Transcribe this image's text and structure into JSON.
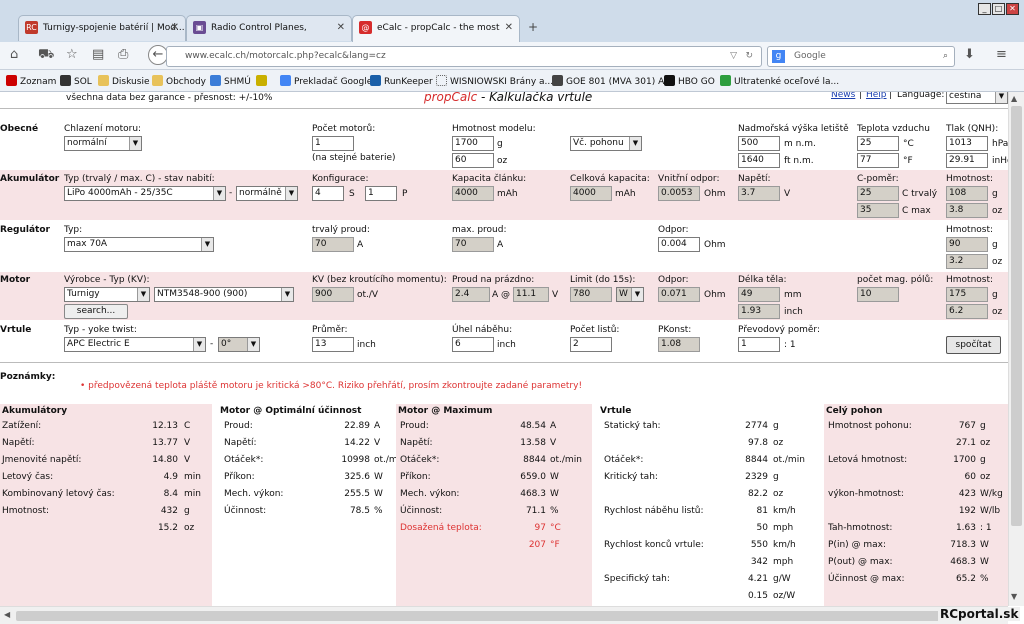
{
  "browser": {
    "tabs": [
      {
        "label": "Turnigy-spojenie batérií | Mod...",
        "fav": "RC",
        "fav_color": "#c0392b"
      },
      {
        "label": "Radio Control Planes, Helicop...",
        "fav": "▣",
        "fav_color": "#6a4c93"
      },
      {
        "label": "eCalc - propCalc - the most re...",
        "fav": "@",
        "fav_color": "#d62c2c"
      }
    ],
    "url": "www.ecalc.ch/motorcalc.php?ecalc&lang=cz",
    "search_placeholder": "Google",
    "bookmarks": [
      "Zoznam",
      "SOL",
      "Diskusie",
      "Obchody",
      "SHMÚ",
      "Prekladač Google",
      "RunKeeper",
      "WISNIOWSKI Brány a...",
      "GOE 801 (MVA 301) A...",
      "HBO GO",
      "Ultratenké oceľové la..."
    ]
  },
  "header": {
    "disclaimer": "všechna data bez garance - přesnost: +/-10%",
    "title_brand": "propCalc",
    "title_rest": " - Kalkulačka vrtule",
    "news": "News",
    "help": "Help",
    "language_label": "Language:",
    "language_value": "čeština"
  },
  "obecne": {
    "section": "Obecné",
    "cooling_label": "Chlazení motoru:",
    "cooling_value": "normální",
    "motors_label": "Počet motorů:",
    "motors_value": "1",
    "motors_note": "(na stejné baterie)",
    "weight_label": "Hmotnost modelu:",
    "weight_g": "1700",
    "weight_g_unit": "g",
    "weight_oz": "60",
    "weight_oz_unit": "oz",
    "weight_mode": "Vč. pohonu",
    "altitude_label": "Nadmořská výška letiště",
    "alt_m": "500",
    "alt_m_unit": "m n.m.",
    "alt_ft": "1640",
    "alt_ft_unit": "ft n.m.",
    "temp_label": "Teplota vzduchu",
    "temp_c": "25",
    "temp_c_unit": "°C",
    "temp_f": "77",
    "temp_f_unit": "°F",
    "qnh_label": "Tlak (QNH):",
    "qnh_hpa": "1013",
    "qnh_hpa_unit": "hPa",
    "qnh_inhg": "29.91",
    "qnh_inhg_unit": "inHg"
  },
  "akumulator": {
    "section": "Akumulátor",
    "type_label": "Typ (trvalý / max. C) - stav nabití:",
    "type_value": "LiPo 4000mAh - 25/35C",
    "dash": "-",
    "state_value": "normálně",
    "config_label": "Konfigurace:",
    "cfg_s": "4",
    "s": "S",
    "cfg_p": "1",
    "p": "P",
    "capacity_label": "Kapacita článku:",
    "capacity": "4000",
    "capacity_unit": "mAh",
    "total_label": "Celková kapacita:",
    "total": "4000",
    "total_unit": "mAh",
    "resistance_label": "Vnitřní odpor:",
    "resistance": "0.0053",
    "resistance_unit": "Ohm",
    "voltage_label": "Napětí:",
    "voltage": "3.7",
    "voltage_unit": "V",
    "c_label": "C-poměr:",
    "c_cont": "25",
    "c_cont_unit": "C trvalý",
    "c_max": "35",
    "c_max_unit": "C max",
    "mass_label": "Hmotnost:",
    "mass_g": "108",
    "mass_g_unit": "g",
    "mass_oz": "3.8",
    "mass_oz_unit": "oz"
  },
  "regulator": {
    "section": "Regulátor",
    "type_label": "Typ:",
    "type_value": "max 70A",
    "cont_label": "trvalý proud:",
    "cont": "70",
    "cont_unit": "A",
    "max_label": "max. proud:",
    "max": "70",
    "max_unit": "A",
    "res_label": "Odpor:",
    "res": "0.004",
    "res_unit": "Ohm",
    "mass_label": "Hmotnost:",
    "mass_g": "90",
    "mass_g_unit": "g",
    "mass_oz": "3.2",
    "mass_oz_unit": "oz"
  },
  "motor": {
    "section": "Motor",
    "maker_label": "Výrobce - Typ (KV):",
    "maker": "Turnigy",
    "model": "NTM3548-900 (900)",
    "search": "search...",
    "kv_label": "KV (bez kroutícího momentu):",
    "kv": "900",
    "kv_unit": "ot./V",
    "noload_label": "Proud na prázdno:",
    "noload_a": "2.4",
    "noload_at": "A @",
    "noload_v": "11.1",
    "noload_v_unit": "V",
    "limit_label": "Limit (do 15s):",
    "limit": "780",
    "limit_unit": "W",
    "res_label": "Odpor:",
    "res": "0.071",
    "res_unit": "Ohm",
    "length_label": "Délka těla:",
    "length_mm": "49",
    "length_mm_unit": "mm",
    "length_in": "1.93",
    "length_in_unit": "inch",
    "poles_label": "počet mag. pólů:",
    "poles": "10",
    "mass_label": "Hmotnost:",
    "mass_g": "175",
    "mass_g_unit": "g",
    "mass_oz": "6.2",
    "mass_oz_unit": "oz"
  },
  "vrtule": {
    "section": "Vrtule",
    "type_label": "Typ - yoke twist:",
    "type_value": "APC Electric E",
    "dash": "-",
    "twist": "0°",
    "diameter_label": "Průměr:",
    "diameter": "13",
    "diameter_unit": "inch",
    "pitch_label": "Úhel náběhu:",
    "pitch": "6",
    "pitch_unit": "inch",
    "blades_label": "Počet listů:",
    "blades": "2",
    "pconst_label": "PKonst:",
    "pconst": "1.08",
    "gear_label": "Převodový poměr:",
    "gear": "1",
    "gear_unit": ": 1",
    "calc": "spočítat"
  },
  "notes": {
    "label": "Poznámky:",
    "warning": "předpovězená teplota pláště motoru je kritická >80°C. Riziko přehřátí, prosím zkontroujte zadané parametry!"
  },
  "results": {
    "akumulatory": {
      "title": "Akumulátory",
      "rows": [
        {
          "k": "Zatížení:",
          "v": "12.13",
          "u": "C"
        },
        {
          "k": "Napětí:",
          "v": "13.77",
          "u": "V"
        },
        {
          "k": "Jmenovité napětí:",
          "v": "14.80",
          "u": "V"
        },
        {
          "k": "Letový čas:",
          "v": "4.9",
          "u": "min"
        },
        {
          "k": "Kombinovaný letový čas:",
          "v": "8.4",
          "u": "min"
        },
        {
          "k": "Hmotnost:",
          "v": "432",
          "u": "g"
        },
        {
          "k": "",
          "v": "15.2",
          "u": "oz"
        }
      ]
    },
    "motor_opt": {
      "title": "Motor @ Optimální účinnost",
      "rows": [
        {
          "k": "Proud:",
          "v": "22.89",
          "u": "A"
        },
        {
          "k": "Napětí:",
          "v": "14.22",
          "u": "V"
        },
        {
          "k": "Otáček*:",
          "v": "10998",
          "u": "ot./min"
        },
        {
          "k": "Příkon:",
          "v": "325.6",
          "u": "W"
        },
        {
          "k": "Mech. výkon:",
          "v": "255.5",
          "u": "W"
        },
        {
          "k": "Účinnost:",
          "v": "78.5",
          "u": "%"
        }
      ]
    },
    "motor_max": {
      "title": "Motor @ Maximum",
      "rows": [
        {
          "k": "Proud:",
          "v": "48.54",
          "u": "A"
        },
        {
          "k": "Napětí:",
          "v": "13.58",
          "u": "V"
        },
        {
          "k": "Otáček*:",
          "v": "8844",
          "u": "ot./min"
        },
        {
          "k": "Příkon:",
          "v": "659.0",
          "u": "W"
        },
        {
          "k": "Mech. výkon:",
          "v": "468.3",
          "u": "W"
        },
        {
          "k": "Účinnost:",
          "v": "71.1",
          "u": "%"
        },
        {
          "k": "Dosažená teplota:",
          "v": "97",
          "u": "°C"
        },
        {
          "k": "",
          "v": "207",
          "u": "°F"
        }
      ]
    },
    "vrtule": {
      "title": "Vrtule",
      "static_thrust": "Statický tah:",
      "st_g": "2774",
      "st_g_u": "g",
      "st_oz": "97.8",
      "st_oz_u": "oz",
      "rpm": "Otáček*:",
      "rpm_v": "8844",
      "rpm_u": "ot./min",
      "crit": "Kritický tah:",
      "crit_g": "2329",
      "crit_g_u": "g",
      "crit_oz": "82.2",
      "crit_oz_u": "oz",
      "pitch_speed": "Rychlost náběhu listů:",
      "ps_kmh": "81",
      "ps_kmh_u": "km/h",
      "ps_mph": "50",
      "ps_mph_u": "mph",
      "tip_speed": "Rychlost konců vrtule:",
      "ts_kmh": "550",
      "ts_kmh_u": "km/h",
      "ts_mph": "342",
      "ts_mph_u": "mph",
      "spec": "Specifický tah:",
      "sp_gw": "4.21",
      "sp_gw_u": "g/W",
      "sp_ozw": "0.15",
      "sp_ozw_u": "oz/W"
    },
    "cely": {
      "title": "Celý pohon",
      "rows": [
        {
          "k": "Hmotnost pohonu:",
          "v": "767",
          "u": "g"
        },
        {
          "k": "",
          "v": "27.1",
          "u": "oz"
        },
        {
          "k": "Letová hmotnost:",
          "v": "1700",
          "u": "g"
        },
        {
          "k": "",
          "v": "60",
          "u": "oz"
        },
        {
          "k": "výkon-hmotnost:",
          "v": "423",
          "u": "W/kg"
        },
        {
          "k": "",
          "v": "192",
          "u": "W/lb"
        },
        {
          "k": "Tah-hmotnost:",
          "v": "1.63",
          "u": ": 1"
        },
        {
          "k": "P(in) @ max:",
          "v": "718.3",
          "u": "W"
        },
        {
          "k": "P(out) @ max:",
          "v": "468.3",
          "u": "W"
        },
        {
          "k": "Účinnost @ max:",
          "v": "65.2",
          "u": "%"
        }
      ]
    }
  },
  "watermark": "RCportal.sk"
}
